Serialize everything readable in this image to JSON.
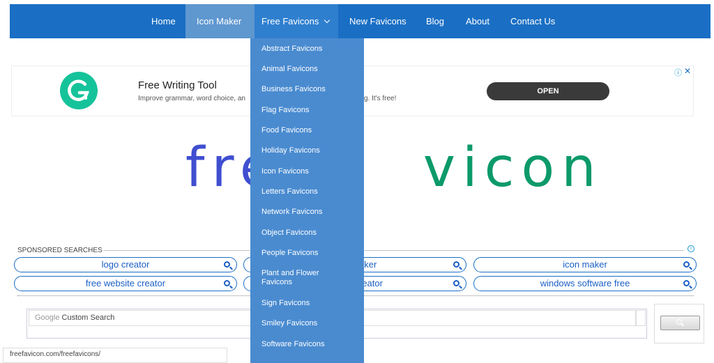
{
  "nav": {
    "items": [
      {
        "label": "Home"
      },
      {
        "label": "Icon Maker"
      },
      {
        "label": "Free Favicons"
      },
      {
        "label": "New Favicons"
      },
      {
        "label": "Blog"
      },
      {
        "label": "About"
      },
      {
        "label": "Contact Us"
      }
    ],
    "color": "#1a6fc4"
  },
  "dropdown": {
    "items": [
      "Abstract Favicons",
      "Animal Favicons",
      "Business Favicons",
      "Flag Favicons",
      "Food Favicons",
      "Holiday Favicons",
      "Icon Favicons",
      "Letters Favicons",
      "Network Favicons",
      "Object Favicons",
      "People Favicons",
      "Plant and Flower Favicons",
      "Sign Favicons",
      "Smiley Favicons",
      "Software Favicons"
    ]
  },
  "ad": {
    "title": "Free Writing Tool",
    "description_left": "Improve grammar, word choice, an",
    "description_right": "g. It's free!",
    "open_label": "OPEN",
    "info_icon": "info-icon",
    "close_icon": "close-icon",
    "brand_color": "#15c39a"
  },
  "logo": {
    "part1": "fre",
    "part2": "vicon",
    "color1": "#3f4fd0",
    "color2": "#0c9a6a"
  },
  "sponsored": {
    "label": "SPONSORED SEARCHES",
    "pills": [
      "logo creator",
      "aker",
      "icon maker",
      "free website creator",
      "reator",
      "windows software free"
    ]
  },
  "search": {
    "placeholder_brand": "Google",
    "placeholder": "Custom Search"
  },
  "status_bar": {
    "url": "freefavicon.com/freefavicons/"
  }
}
